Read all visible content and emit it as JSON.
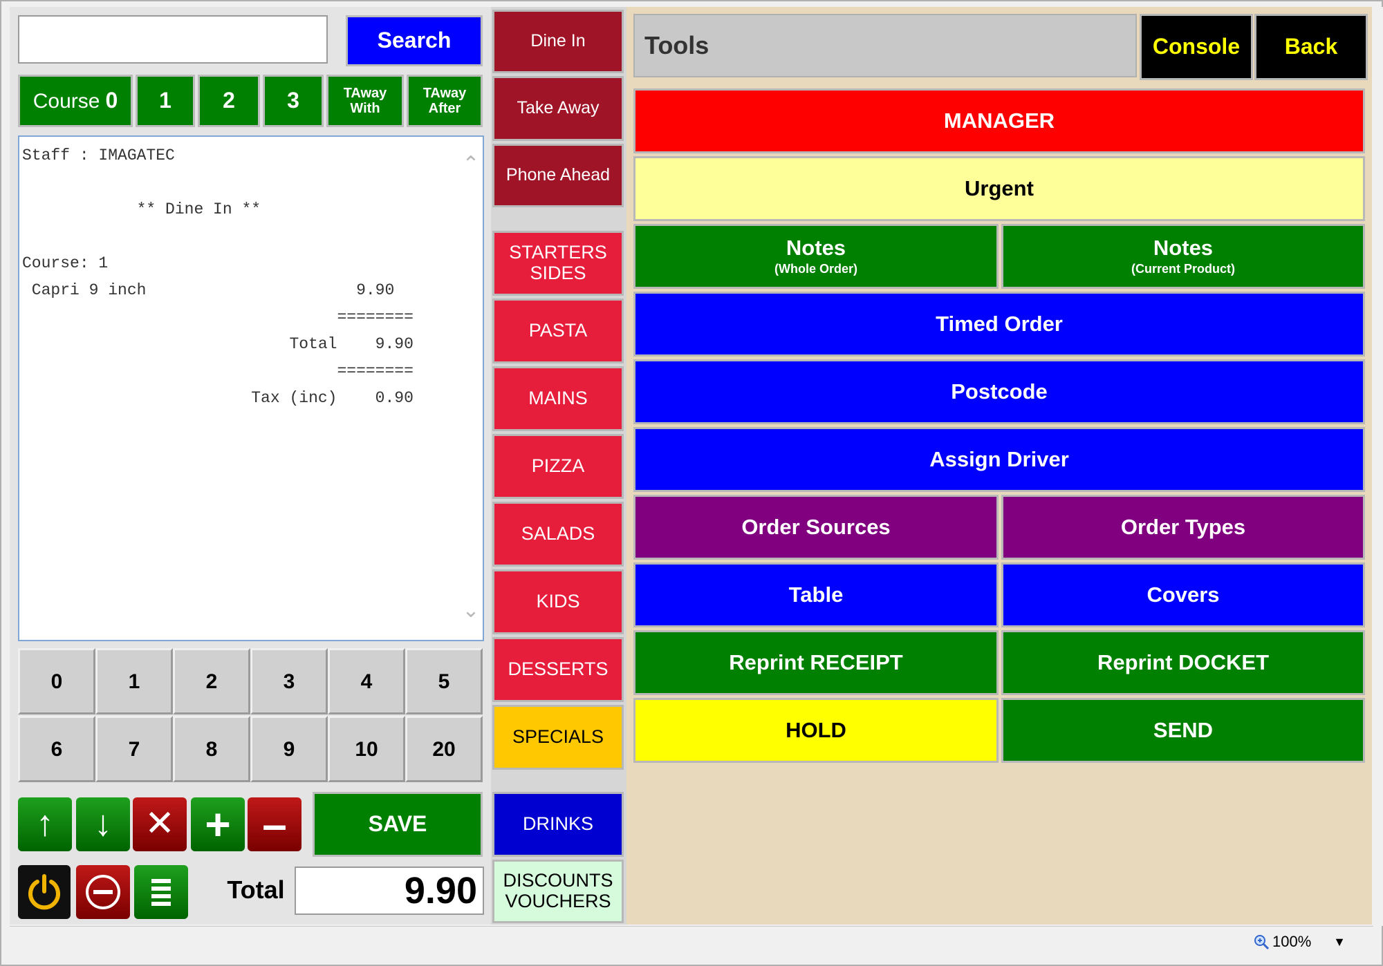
{
  "search": {
    "placeholder": "",
    "value": "",
    "button_label": "Search"
  },
  "course": {
    "course0_label": "Course",
    "course0_num": "0",
    "c1": "1",
    "c2": "2",
    "c3": "3",
    "taway_with_1": "TAway",
    "taway_with_2": "With",
    "taway_after_1": "TAway",
    "taway_after_2": "After"
  },
  "receipt": {
    "text": "Staff : IMAGATEC\n\n            ** Dine In **\n\nCourse: 1\n Capri 9 inch                      9.90\n                                 ========\n                            Total    9.90\n                                 ========\n                        Tax (inc)    0.90"
  },
  "keypad": {
    "keys": [
      "0",
      "1",
      "2",
      "3",
      "4",
      "5",
      "6",
      "7",
      "8",
      "9",
      "10",
      "20"
    ]
  },
  "controls": {
    "save_label": "SAVE",
    "total_label": "Total",
    "total_value": "9.90"
  },
  "order_modes": {
    "dine_in": "Dine In",
    "take_away": "Take Away",
    "phone_ahead": "Phone Ahead"
  },
  "categories": {
    "starters_1": "STARTERS",
    "starters_2": "SIDES",
    "pasta": "PASTA",
    "mains": "MAINS",
    "pizza": "PIZZA",
    "salads": "SALADS",
    "kids": "KIDS",
    "desserts": "DESSERTS",
    "specials": "SPECIALS",
    "drinks": "DRINKS",
    "discounts_1": "DISCOUNTS",
    "discounts_2": "VOUCHERS"
  },
  "tools": {
    "title": "Tools",
    "console": "Console",
    "back": "Back",
    "manager": "MANAGER",
    "urgent": "Urgent",
    "notes_whole": "Notes",
    "notes_whole_sub": "(Whole Order)",
    "notes_current": "Notes",
    "notes_current_sub": "(Current Product)",
    "timed_order": "Timed Order",
    "postcode": "Postcode",
    "assign_driver": "Assign Driver",
    "order_sources": "Order Sources",
    "order_types": "Order Types",
    "table": "Table",
    "covers": "Covers",
    "reprint_receipt": "Reprint RECEIPT",
    "reprint_docket": "Reprint DOCKET",
    "hold": "HOLD",
    "send": "SEND"
  },
  "status": {
    "zoom": "100%"
  },
  "colors": {
    "green": "#008000",
    "blue": "#0000ff",
    "red": "#ff0000",
    "purple": "#800080",
    "yellow": "#ffff00",
    "category_red": "#e61e3c",
    "mode_red": "#a01428"
  }
}
